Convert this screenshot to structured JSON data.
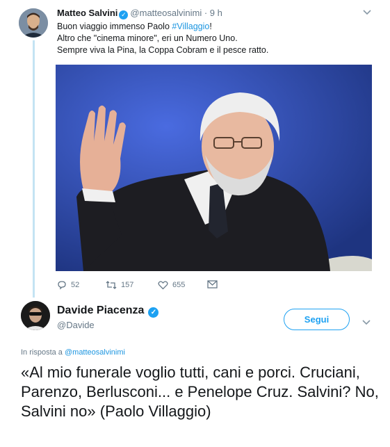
{
  "tweet1": {
    "author_name": "Matteo Salvini",
    "handle": "@matteosalvinimi",
    "time": "· 9 h",
    "lines": [
      {
        "before": "Buon viaggio immenso Paolo ",
        "hashtag": "#Villaggio",
        "after": "!"
      },
      {
        "before": "Altro che \"cinema minore\", eri un Numero Uno.",
        "hashtag": "",
        "after": ""
      },
      {
        "before": "Sempre viva la Pina, la Coppa Cobram e il pesce ratto.",
        "hashtag": "",
        "after": ""
      }
    ],
    "stats": {
      "replies": "52",
      "retweets": "157",
      "likes": "655"
    },
    "icons": {
      "reply": "reply-icon",
      "retweet": "retweet-icon",
      "like": "heart-icon",
      "dm": "envelope-icon",
      "menu": "chevron-down-icon",
      "verified": "verified-badge-icon"
    }
  },
  "tweet2": {
    "author_name": "Davide Piacenza",
    "handle": "@Davide",
    "follow_label": "Segui",
    "reply_prefix": "In risposta a",
    "reply_mention": "@matteosalvinimi",
    "text": "«Al mio funerale voglio tutti, cani e porci. Cruciani, Parenzo, Berlusconi... e Penelope Cruz. Salvini? No, Salvini no» (Paolo Villaggio)"
  },
  "colors": {
    "accent": "#1da1f2",
    "text": "#14171a",
    "muted": "#657786",
    "thread": "#c4e3f3"
  }
}
